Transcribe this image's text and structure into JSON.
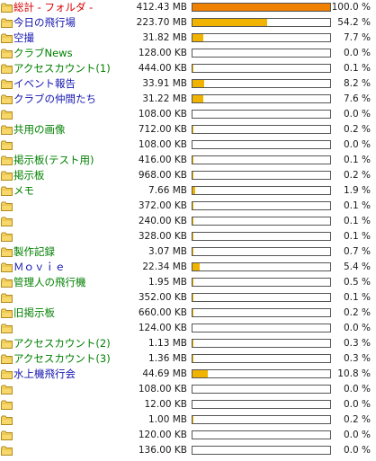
{
  "colors": {
    "bar_total": "#f08000",
    "bar_normal": "#f0b400",
    "name_red": "#d40000",
    "name_blue": "#1515b0",
    "name_green": "#008000"
  },
  "icons": {
    "row_icon": "folder-icon"
  },
  "rows": [
    {
      "name": "総計 - フォルダ -",
      "size": "412.43 MB",
      "percent": "100.0 %",
      "fill": 1.0,
      "color": "red",
      "bar": "total"
    },
    {
      "name": "今日の飛行場",
      "size": "223.70 MB",
      "percent": "54.2 %",
      "fill": 0.542,
      "color": "blue",
      "bar": "normal"
    },
    {
      "name": "空撮",
      "size": "31.82 MB",
      "percent": "7.7 %",
      "fill": 0.077,
      "color": "blue",
      "bar": "normal"
    },
    {
      "name": "クラブNews",
      "size": "128.00 KB",
      "percent": "0.0 %",
      "fill": 0.0,
      "color": "green",
      "bar": "normal"
    },
    {
      "name": "アクセスカウント(1)",
      "size": "444.00 KB",
      "percent": "0.1 %",
      "fill": 0.001,
      "color": "green",
      "bar": "normal"
    },
    {
      "name": "イベント報告",
      "size": "33.91 MB",
      "percent": "8.2 %",
      "fill": 0.082,
      "color": "blue",
      "bar": "normal"
    },
    {
      "name": "クラブの仲間たち",
      "size": "31.22 MB",
      "percent": "7.6 %",
      "fill": 0.076,
      "color": "blue",
      "bar": "normal"
    },
    {
      "name": "",
      "size": "108.00 KB",
      "percent": "0.0 %",
      "fill": 0.0,
      "color": "green",
      "bar": "normal"
    },
    {
      "name": "共用の画像",
      "size": "712.00 KB",
      "percent": "0.2 %",
      "fill": 0.002,
      "color": "green",
      "bar": "normal"
    },
    {
      "name": "",
      "size": "108.00 KB",
      "percent": "0.0 %",
      "fill": 0.0,
      "color": "green",
      "bar": "normal"
    },
    {
      "name": "掲示板(テスト用)",
      "size": "416.00 KB",
      "percent": "0.1 %",
      "fill": 0.001,
      "color": "green",
      "bar": "normal"
    },
    {
      "name": "掲示板",
      "size": "968.00 KB",
      "percent": "0.2 %",
      "fill": 0.002,
      "color": "green",
      "bar": "normal"
    },
    {
      "name": "メモ",
      "size": "7.66 MB",
      "percent": "1.9 %",
      "fill": 0.019,
      "color": "green",
      "bar": "normal"
    },
    {
      "name": "",
      "size": "372.00 KB",
      "percent": "0.1 %",
      "fill": 0.001,
      "color": "green",
      "bar": "normal"
    },
    {
      "name": "",
      "size": "240.00 KB",
      "percent": "0.1 %",
      "fill": 0.001,
      "color": "green",
      "bar": "normal"
    },
    {
      "name": "",
      "size": "328.00 KB",
      "percent": "0.1 %",
      "fill": 0.001,
      "color": "green",
      "bar": "normal"
    },
    {
      "name": "製作記録",
      "size": "3.07 MB",
      "percent": "0.7 %",
      "fill": 0.007,
      "color": "green",
      "bar": "normal"
    },
    {
      "name": "Ｍｏｖｉｅ",
      "size": "22.34 MB",
      "percent": "5.4 %",
      "fill": 0.054,
      "color": "blue",
      "bar": "normal"
    },
    {
      "name": "管理人の飛行機",
      "size": "1.95 MB",
      "percent": "0.5 %",
      "fill": 0.005,
      "color": "green",
      "bar": "normal"
    },
    {
      "name": "",
      "size": "352.00 KB",
      "percent": "0.1 %",
      "fill": 0.001,
      "color": "green",
      "bar": "normal"
    },
    {
      "name": "旧掲示板",
      "size": "660.00 KB",
      "percent": "0.2 %",
      "fill": 0.002,
      "color": "green",
      "bar": "normal"
    },
    {
      "name": "",
      "size": "124.00 KB",
      "percent": "0.0 %",
      "fill": 0.0,
      "color": "green",
      "bar": "normal"
    },
    {
      "name": "アクセスカウント(2)",
      "size": "1.13 MB",
      "percent": "0.3 %",
      "fill": 0.003,
      "color": "green",
      "bar": "normal"
    },
    {
      "name": "アクセスカウント(3)",
      "size": "1.36 MB",
      "percent": "0.3 %",
      "fill": 0.003,
      "color": "green",
      "bar": "normal"
    },
    {
      "name": "水上機飛行会",
      "size": "44.69 MB",
      "percent": "10.8 %",
      "fill": 0.108,
      "color": "blue",
      "bar": "normal"
    },
    {
      "name": "",
      "size": "108.00 KB",
      "percent": "0.0 %",
      "fill": 0.0,
      "color": "green",
      "bar": "normal"
    },
    {
      "name": "",
      "size": "12.00 KB",
      "percent": "0.0 %",
      "fill": 0.0,
      "color": "green",
      "bar": "normal"
    },
    {
      "name": "",
      "size": "1.00 MB",
      "percent": "0.2 %",
      "fill": 0.002,
      "color": "green",
      "bar": "normal"
    },
    {
      "name": "",
      "size": "120.00 KB",
      "percent": "0.0 %",
      "fill": 0.0,
      "color": "green",
      "bar": "normal"
    },
    {
      "name": "",
      "size": "136.00 KB",
      "percent": "0.0 %",
      "fill": 0.0,
      "color": "green",
      "bar": "normal"
    }
  ]
}
